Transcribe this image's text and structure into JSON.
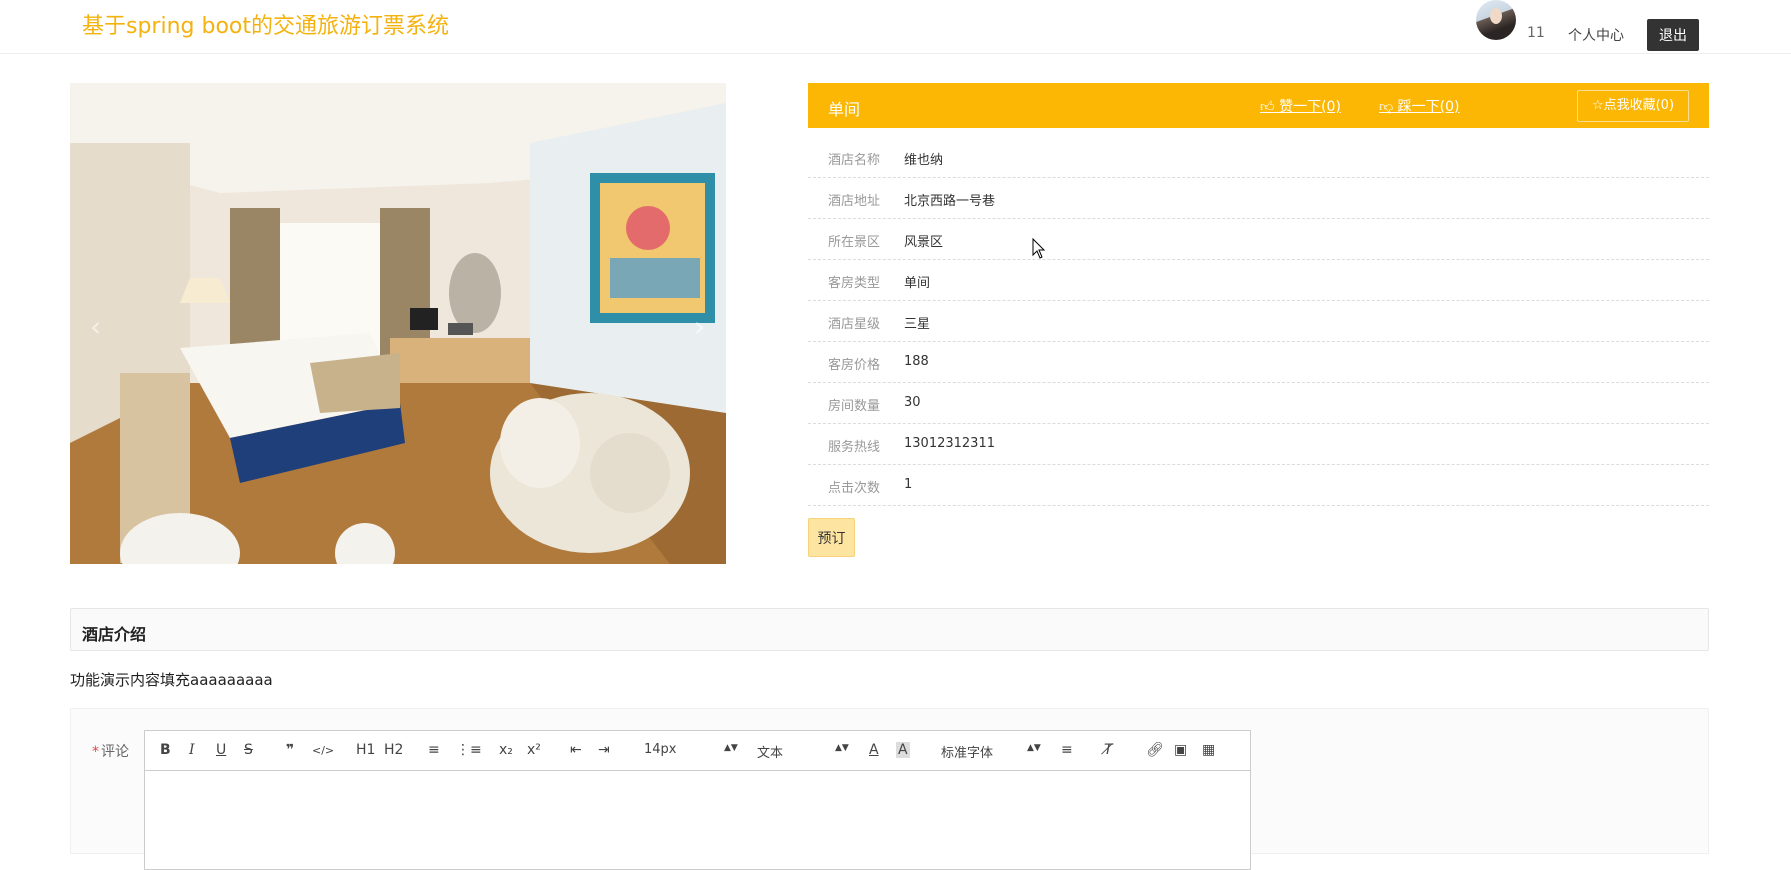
{
  "header": {
    "site_title": "基于spring boot的交通旅游订票系统",
    "username": "11",
    "user_center": "个人中心",
    "logout": "退出"
  },
  "carousel": {
    "prev_icon": "chevron-left",
    "next_icon": "chevron-right"
  },
  "detail": {
    "title": "单间",
    "like_label": "赞一下(0)",
    "dislike_label": "踩一下(0)",
    "favorite_label": "点我收藏(0)",
    "rows": [
      {
        "label": "酒店名称",
        "value": "维也纳"
      },
      {
        "label": "酒店地址",
        "value": "北京西路一号巷"
      },
      {
        "label": "所在景区",
        "value": "风景区"
      },
      {
        "label": "客房类型",
        "value": "单间"
      },
      {
        "label": "酒店星级",
        "value": "三星"
      },
      {
        "label": "客房价格",
        "value": "188"
      },
      {
        "label": "房间数量",
        "value": "30"
      },
      {
        "label": "服务热线",
        "value": "13012312311"
      },
      {
        "label": "点击次数",
        "value": "1"
      }
    ],
    "book_label": "预订"
  },
  "intro": {
    "title": "酒店介绍",
    "content": "功能演示内容填充aaaaaaaaa"
  },
  "comment": {
    "required_mark": "*",
    "label": "评论",
    "toolbar": {
      "bold": "B",
      "italic": "I",
      "underline": "U",
      "strike": "S",
      "quote": "❞",
      "code": "</>",
      "h1": "H1",
      "h2": "H2",
      "sub": "x₂",
      "sup": "x²",
      "font_size": "14px",
      "header_select": "文本",
      "font_family": "标准字体"
    }
  },
  "colors": {
    "accent": "#fcb705",
    "title": "#f4b20f",
    "book_button": "#fde4a0"
  }
}
